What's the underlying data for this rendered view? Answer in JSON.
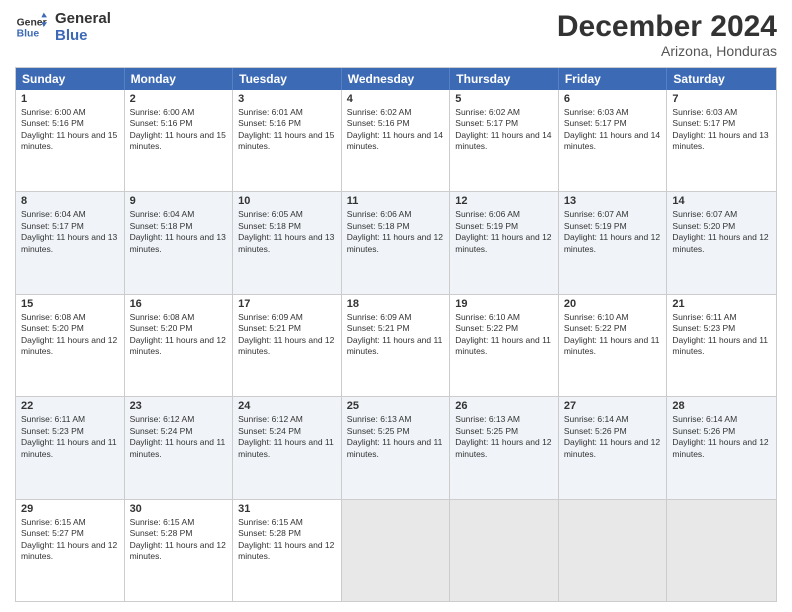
{
  "header": {
    "logo_line1": "General",
    "logo_line2": "Blue",
    "main_title": "December 2024",
    "subtitle": "Arizona, Honduras"
  },
  "calendar": {
    "days_of_week": [
      "Sunday",
      "Monday",
      "Tuesday",
      "Wednesday",
      "Thursday",
      "Friday",
      "Saturday"
    ],
    "weeks": [
      [
        {
          "day": "1",
          "sunrise": "6:00 AM",
          "sunset": "5:16 PM",
          "daylight": "11 hours and 15 minutes."
        },
        {
          "day": "2",
          "sunrise": "6:00 AM",
          "sunset": "5:16 PM",
          "daylight": "11 hours and 15 minutes."
        },
        {
          "day": "3",
          "sunrise": "6:01 AM",
          "sunset": "5:16 PM",
          "daylight": "11 hours and 15 minutes."
        },
        {
          "day": "4",
          "sunrise": "6:02 AM",
          "sunset": "5:16 PM",
          "daylight": "11 hours and 14 minutes."
        },
        {
          "day": "5",
          "sunrise": "6:02 AM",
          "sunset": "5:17 PM",
          "daylight": "11 hours and 14 minutes."
        },
        {
          "day": "6",
          "sunrise": "6:03 AM",
          "sunset": "5:17 PM",
          "daylight": "11 hours and 14 minutes."
        },
        {
          "day": "7",
          "sunrise": "6:03 AM",
          "sunset": "5:17 PM",
          "daylight": "11 hours and 13 minutes."
        }
      ],
      [
        {
          "day": "8",
          "sunrise": "6:04 AM",
          "sunset": "5:17 PM",
          "daylight": "11 hours and 13 minutes."
        },
        {
          "day": "9",
          "sunrise": "6:04 AM",
          "sunset": "5:18 PM",
          "daylight": "11 hours and 13 minutes."
        },
        {
          "day": "10",
          "sunrise": "6:05 AM",
          "sunset": "5:18 PM",
          "daylight": "11 hours and 13 minutes."
        },
        {
          "day": "11",
          "sunrise": "6:06 AM",
          "sunset": "5:18 PM",
          "daylight": "11 hours and 12 minutes."
        },
        {
          "day": "12",
          "sunrise": "6:06 AM",
          "sunset": "5:19 PM",
          "daylight": "11 hours and 12 minutes."
        },
        {
          "day": "13",
          "sunrise": "6:07 AM",
          "sunset": "5:19 PM",
          "daylight": "11 hours and 12 minutes."
        },
        {
          "day": "14",
          "sunrise": "6:07 AM",
          "sunset": "5:20 PM",
          "daylight": "11 hours and 12 minutes."
        }
      ],
      [
        {
          "day": "15",
          "sunrise": "6:08 AM",
          "sunset": "5:20 PM",
          "daylight": "11 hours and 12 minutes."
        },
        {
          "day": "16",
          "sunrise": "6:08 AM",
          "sunset": "5:20 PM",
          "daylight": "11 hours and 12 minutes."
        },
        {
          "day": "17",
          "sunrise": "6:09 AM",
          "sunset": "5:21 PM",
          "daylight": "11 hours and 12 minutes."
        },
        {
          "day": "18",
          "sunrise": "6:09 AM",
          "sunset": "5:21 PM",
          "daylight": "11 hours and 11 minutes."
        },
        {
          "day": "19",
          "sunrise": "6:10 AM",
          "sunset": "5:22 PM",
          "daylight": "11 hours and 11 minutes."
        },
        {
          "day": "20",
          "sunrise": "6:10 AM",
          "sunset": "5:22 PM",
          "daylight": "11 hours and 11 minutes."
        },
        {
          "day": "21",
          "sunrise": "6:11 AM",
          "sunset": "5:23 PM",
          "daylight": "11 hours and 11 minutes."
        }
      ],
      [
        {
          "day": "22",
          "sunrise": "6:11 AM",
          "sunset": "5:23 PM",
          "daylight": "11 hours and 11 minutes."
        },
        {
          "day": "23",
          "sunrise": "6:12 AM",
          "sunset": "5:24 PM",
          "daylight": "11 hours and 11 minutes."
        },
        {
          "day": "24",
          "sunrise": "6:12 AM",
          "sunset": "5:24 PM",
          "daylight": "11 hours and 11 minutes."
        },
        {
          "day": "25",
          "sunrise": "6:13 AM",
          "sunset": "5:25 PM",
          "daylight": "11 hours and 11 minutes."
        },
        {
          "day": "26",
          "sunrise": "6:13 AM",
          "sunset": "5:25 PM",
          "daylight": "11 hours and 12 minutes."
        },
        {
          "day": "27",
          "sunrise": "6:14 AM",
          "sunset": "5:26 PM",
          "daylight": "11 hours and 12 minutes."
        },
        {
          "day": "28",
          "sunrise": "6:14 AM",
          "sunset": "5:26 PM",
          "daylight": "11 hours and 12 minutes."
        }
      ],
      [
        {
          "day": "29",
          "sunrise": "6:15 AM",
          "sunset": "5:27 PM",
          "daylight": "11 hours and 12 minutes."
        },
        {
          "day": "30",
          "sunrise": "6:15 AM",
          "sunset": "5:28 PM",
          "daylight": "11 hours and 12 minutes."
        },
        {
          "day": "31",
          "sunrise": "6:15 AM",
          "sunset": "5:28 PM",
          "daylight": "11 hours and 12 minutes."
        },
        null,
        null,
        null,
        null
      ]
    ]
  }
}
